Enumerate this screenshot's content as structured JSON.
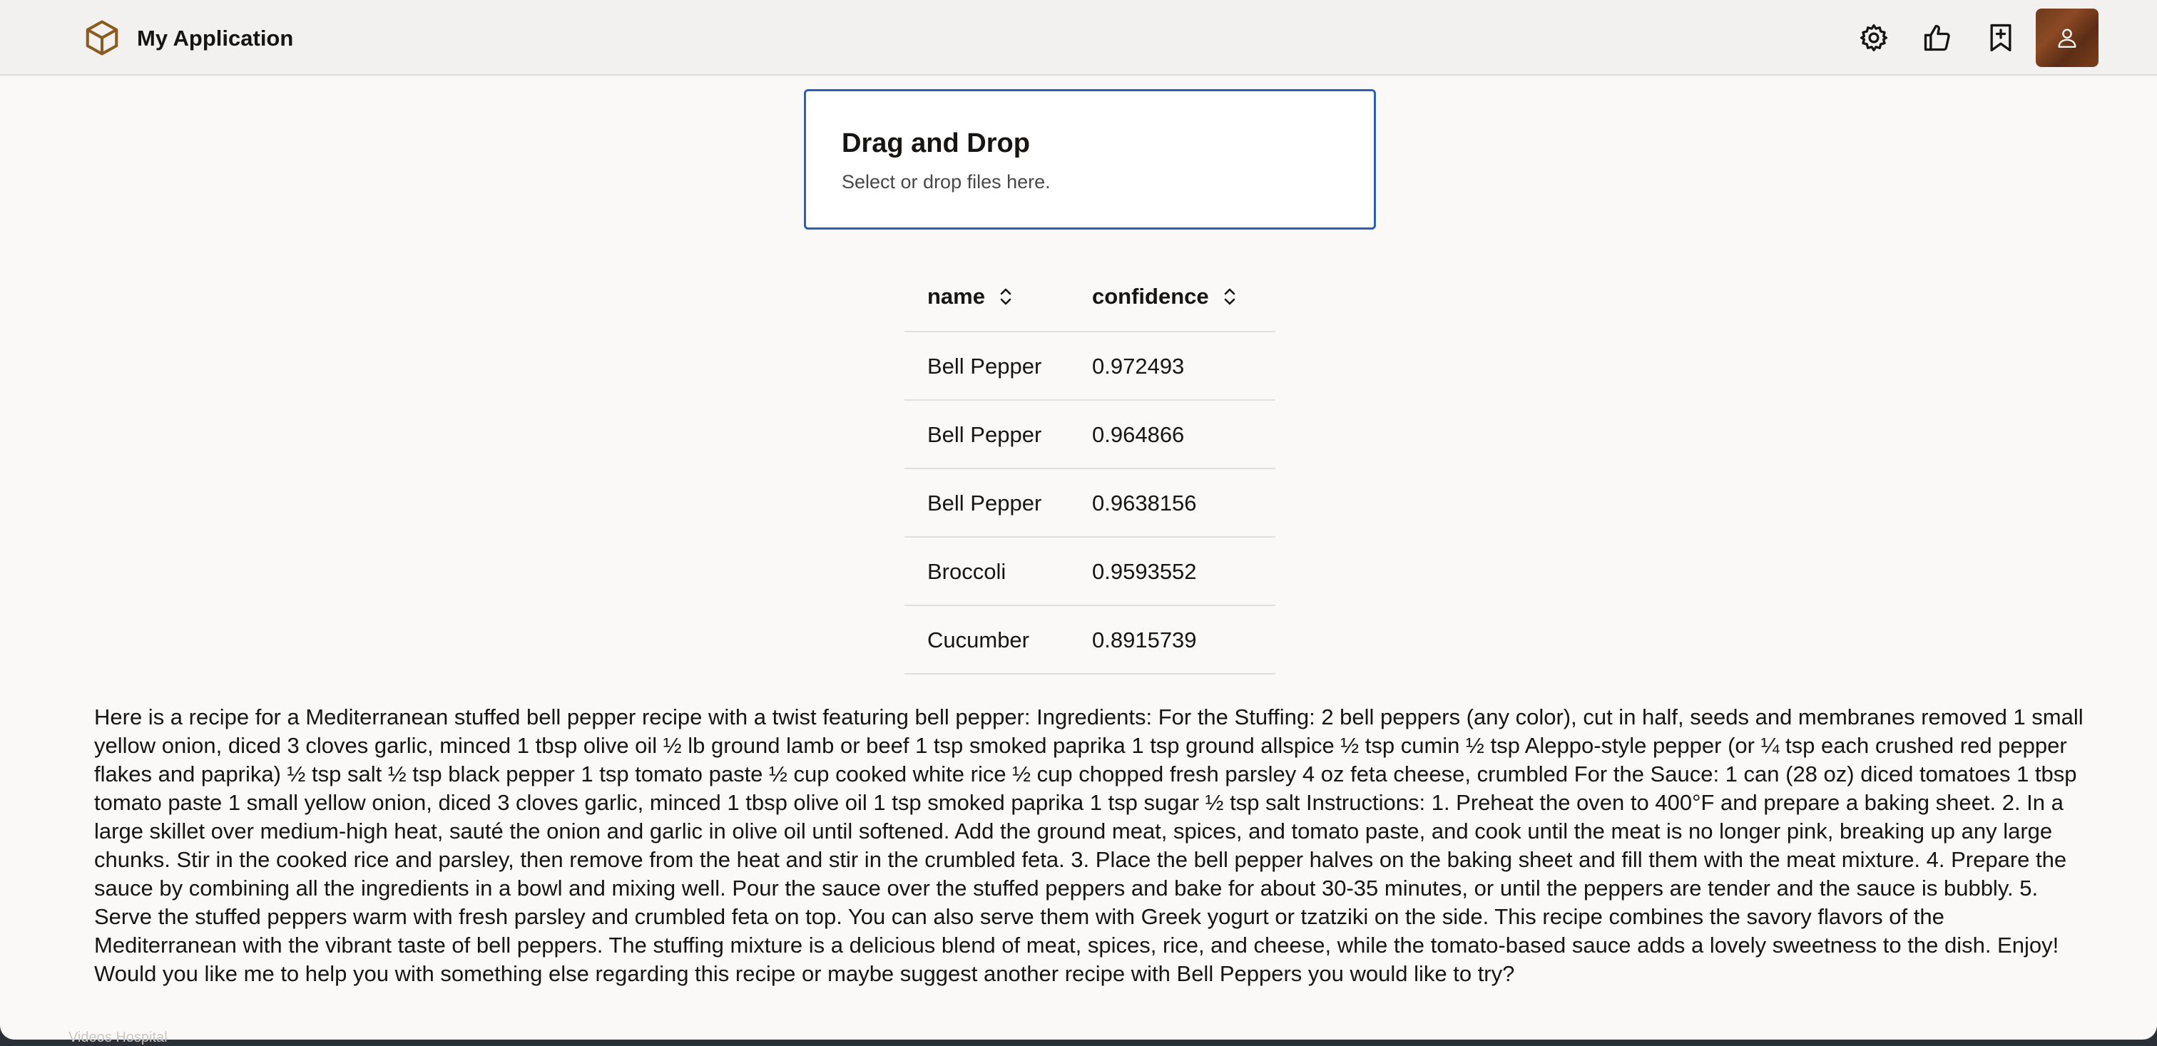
{
  "header": {
    "app_title": "My Application",
    "icons": [
      "settings-icon",
      "thumbs-up-icon",
      "bookmark-add-icon",
      "user-icon"
    ]
  },
  "dropzone": {
    "title": "Drag and Drop",
    "subtitle": "Select or drop files here."
  },
  "table": {
    "columns": [
      "name",
      "confidence"
    ],
    "rows": [
      {
        "name": "Bell Pepper",
        "confidence": "0.972493"
      },
      {
        "name": "Bell Pepper",
        "confidence": "0.964866"
      },
      {
        "name": "Bell Pepper",
        "confidence": "0.9638156"
      },
      {
        "name": "Broccoli",
        "confidence": "0.9593552"
      },
      {
        "name": "Cucumber",
        "confidence": "0.8915739"
      }
    ]
  },
  "recipe_text": "Here is a recipe for a Mediterranean stuffed bell pepper recipe with a twist featuring bell pepper: Ingredients: For the Stuffing: 2 bell peppers (any color), cut in half, seeds and membranes removed 1 small yellow onion, diced 3 cloves garlic, minced 1 tbsp olive oil ½ lb ground lamb or beef 1 tsp smoked paprika 1 tsp ground allspice ½ tsp cumin ½ tsp Aleppo-style pepper (or ¼ tsp each crushed red pepper flakes and paprika) ½ tsp salt ½ tsp black pepper 1 tsp tomato paste ½ cup cooked white rice ½ cup chopped fresh parsley 4 oz feta cheese, crumbled For the Sauce: 1 can (28 oz) diced tomatoes 1 tbsp tomato paste 1 small yellow onion, diced 3 cloves garlic, minced 1 tbsp olive oil 1 tsp smoked paprika 1 tsp sugar ½ tsp salt Instructions: 1. Preheat the oven to 400°F and prepare a baking sheet. 2. In a large skillet over medium-high heat, sauté the onion and garlic in olive oil until softened. Add the ground meat, spices, and tomato paste, and cook until the meat is no longer pink, breaking up any large chunks. Stir in the cooked rice and parsley, then remove from the heat and stir in the crumbled feta. 3. Place the bell pepper halves on the baking sheet and fill them with the meat mixture. 4. Prepare the sauce by combining all the ingredients in a bowl and mixing well. Pour the sauce over the stuffed peppers and bake for about 30-35 minutes, or until the peppers are tender and the sauce is bubbly. 5. Serve the stuffed peppers warm with fresh parsley and crumbled feta on top. You can also serve them with Greek yogurt or tzatziki on the side. This recipe combines the savory flavors of the Mediterranean with the vibrant taste of bell peppers. The stuffing mixture is a delicious blend of meat, spices, rice, and cheese, while the tomato-based sauce adds a lovely sweetness to the dish. Enjoy! Would you like me to help you with something else regarding this recipe or maybe suggest another recipe with Bell Peppers you would like to try?",
  "background_hint": "Videos Hospital"
}
